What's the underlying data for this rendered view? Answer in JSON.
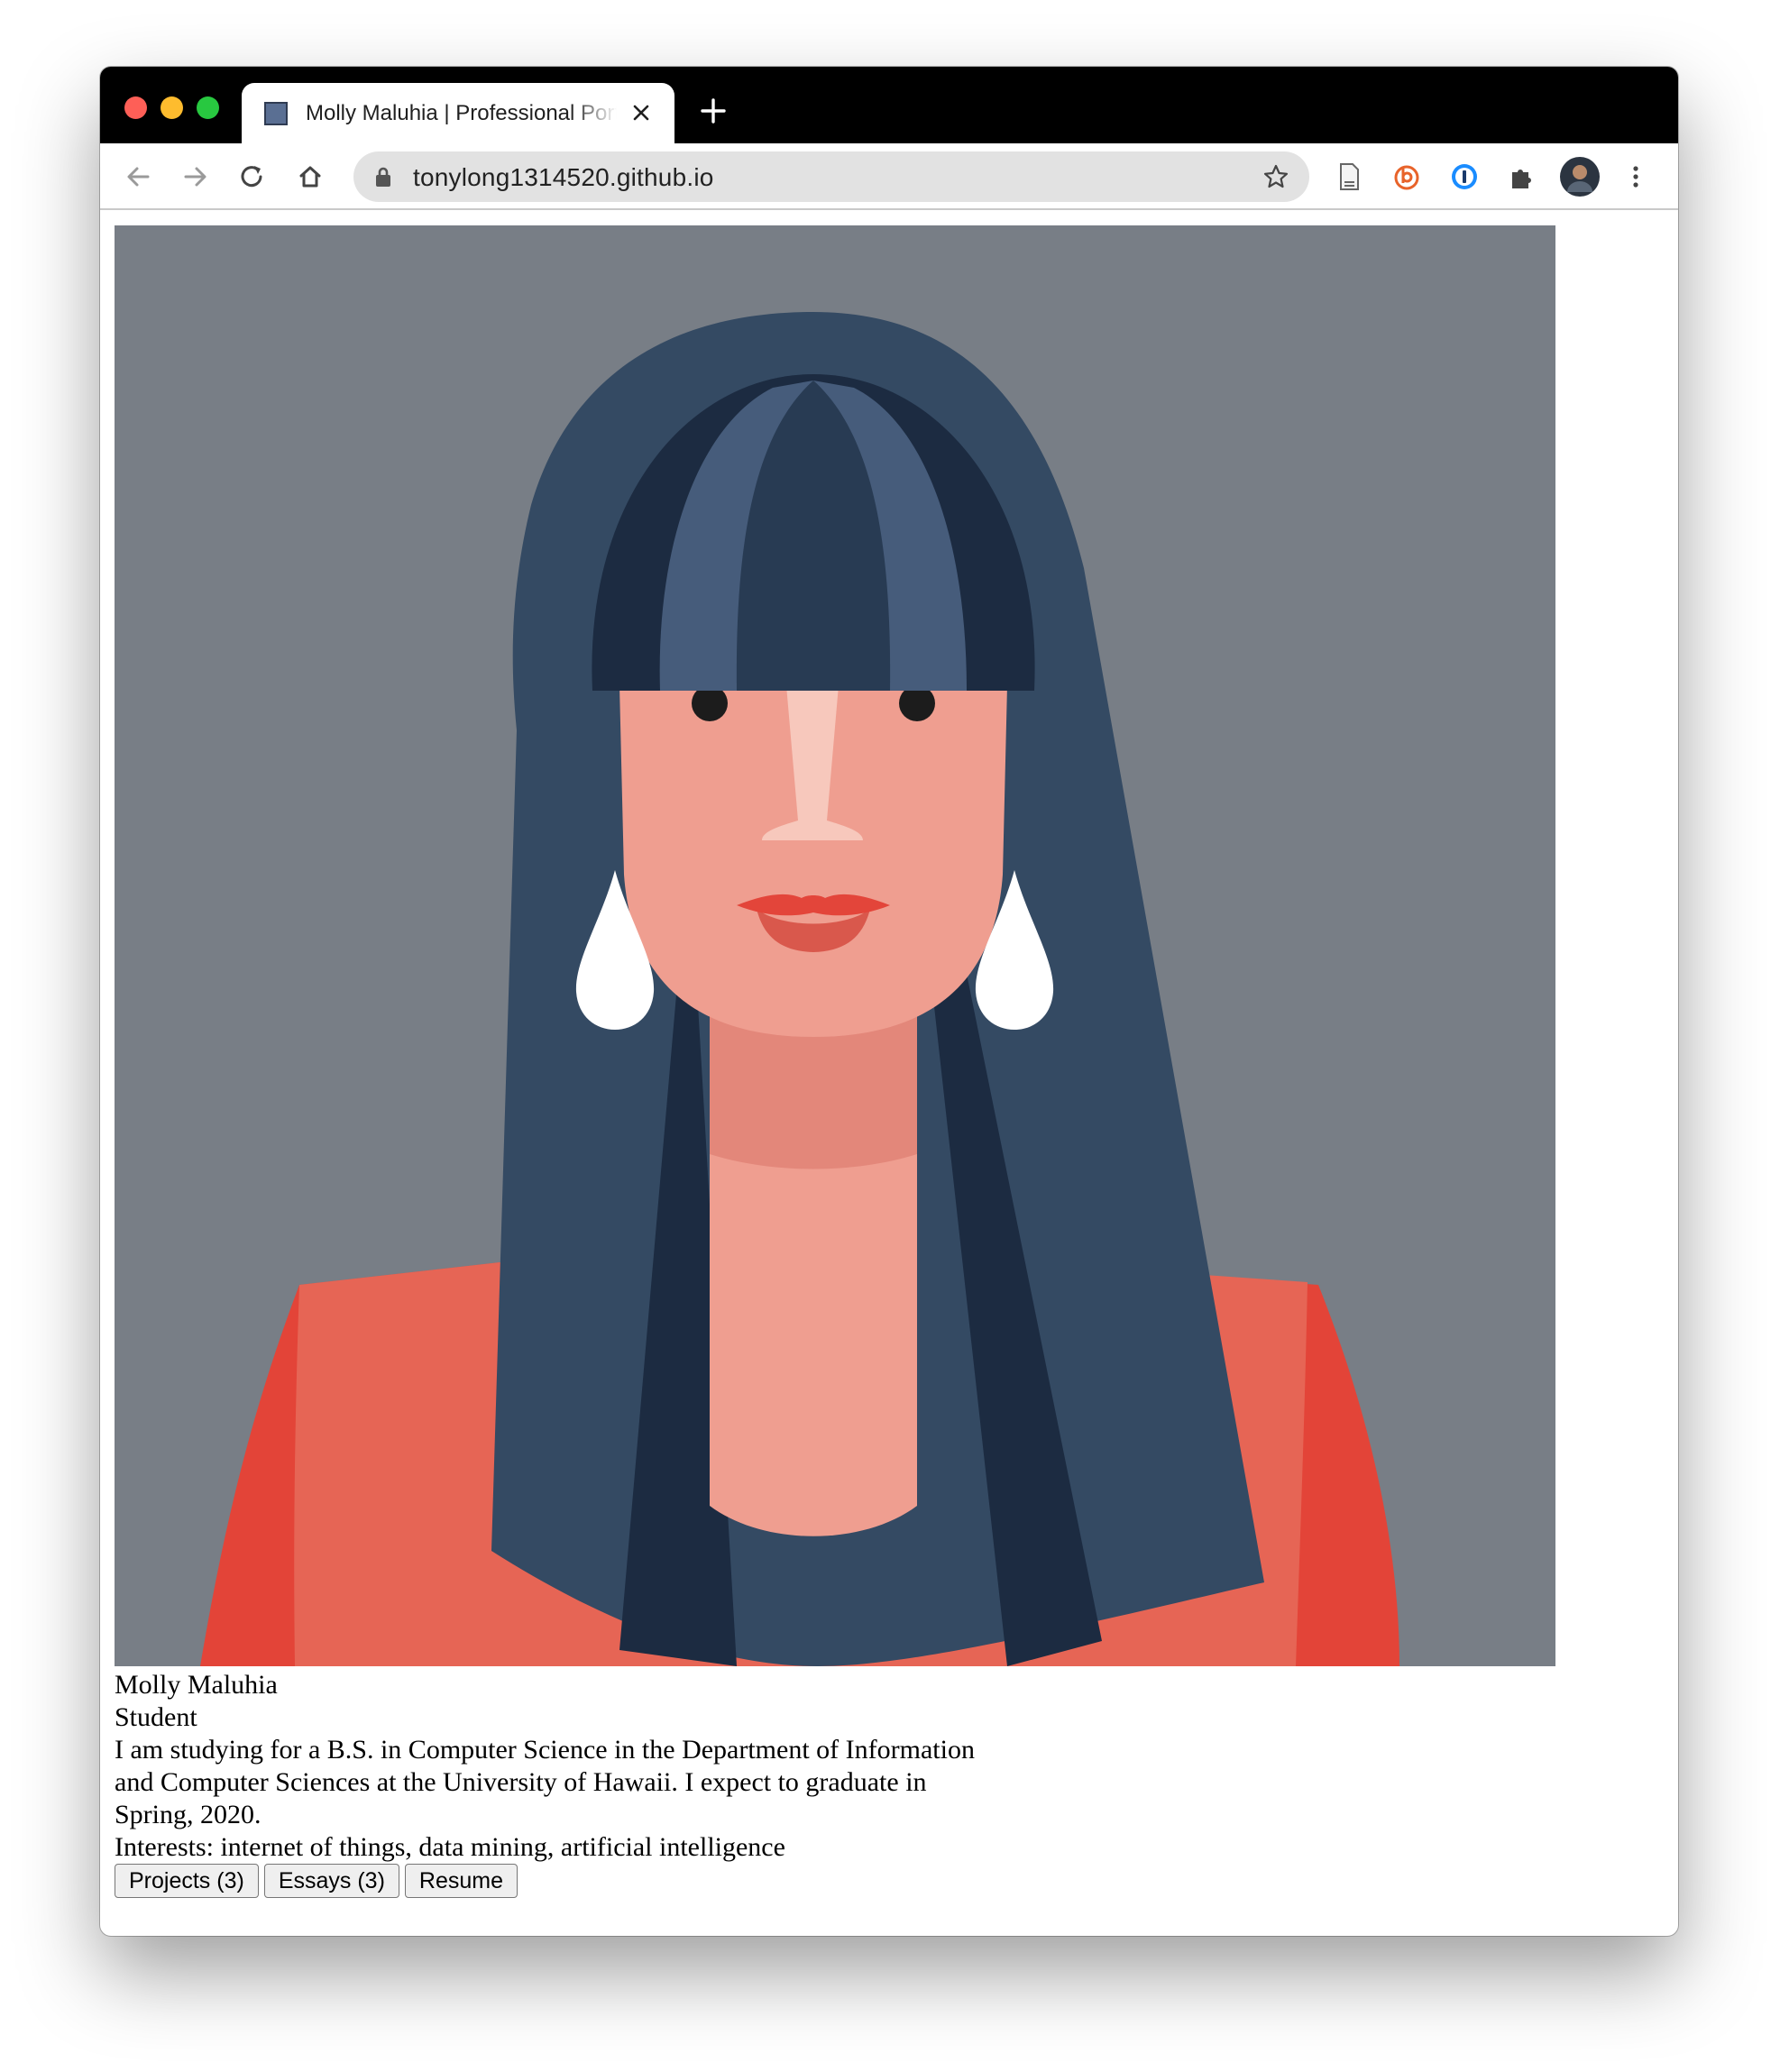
{
  "browser": {
    "tab_title": "Molly Maluhia | Professional Portfolio",
    "url": "tonylong1314520.github.io"
  },
  "profile": {
    "name": "Molly Maluhia",
    "title": "Student",
    "description": "I am studying for a B.S. in Computer Science in the Department of Information and Computer Sciences at the University of Hawaii. I expect to graduate in Spring, 2020.",
    "interests": "Interests: internet of things, data mining, artificial intelligence",
    "buttons": {
      "projects": "Projects (3)",
      "essays": "Essays (3)",
      "resume": "Resume"
    }
  },
  "colors": {
    "portrait_background": "#787e86",
    "hair": "#344a63",
    "skin": "#ef9e90",
    "jacket": "#e5604f"
  }
}
